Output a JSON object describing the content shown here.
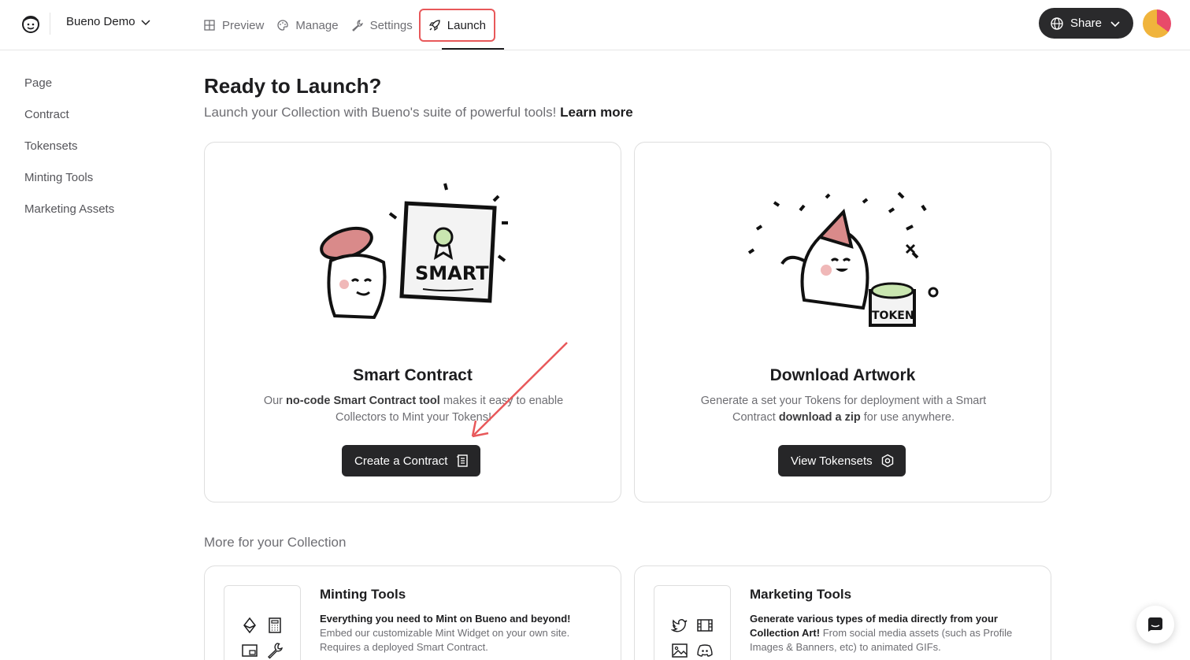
{
  "header": {
    "project_name": "Bueno Demo",
    "tabs": [
      {
        "label": "Preview",
        "icon": "grid-icon"
      },
      {
        "label": "Manage",
        "icon": "palette-icon"
      },
      {
        "label": "Settings",
        "icon": "wrench-icon"
      },
      {
        "label": "Launch",
        "icon": "rocket-icon",
        "active": true
      }
    ],
    "share_label": "Share"
  },
  "sidebar": {
    "items": [
      {
        "label": "Page"
      },
      {
        "label": "Contract"
      },
      {
        "label": "Tokensets"
      },
      {
        "label": "Minting Tools"
      },
      {
        "label": "Marketing Assets"
      }
    ]
  },
  "main": {
    "title": "Ready to Launch?",
    "subtitle": "Launch your Collection with Bueno's suite of powerful tools!",
    "learn_more": "Learn more",
    "cards": [
      {
        "title": "Smart Contract",
        "desc_pre": "Our ",
        "desc_bold": "no-code Smart Contract tool",
        "desc_post": " makes it easy to enable Collectors to Mint your Tokens!",
        "button": "Create a Contract",
        "illustration_text": "SMART"
      },
      {
        "title": "Download Artwork",
        "desc_pre": "Generate a set your Tokens for deployment with a Smart Contract ",
        "desc_bold": "download a zip",
        "desc_post": " for use anywhere.",
        "button": "View Tokensets",
        "illustration_text": "TOKEN"
      }
    ],
    "more_heading": "More for your Collection",
    "tools": [
      {
        "title": "Minting Tools",
        "desc_bold": "Everything you need to Mint on Bueno and beyond!",
        "desc": " Embed our customizable Mint Widget on your own site. Requires a deployed Smart Contract."
      },
      {
        "title": "Marketing Tools",
        "desc_bold": "Generate various types of media directly from your Collection Art!",
        "desc": " From social media assets (such as Profile Images & Banners, etc) to animated GIFs."
      }
    ]
  },
  "colors": {
    "accent_red": "#e8585a",
    "button_dark": "#262628"
  }
}
